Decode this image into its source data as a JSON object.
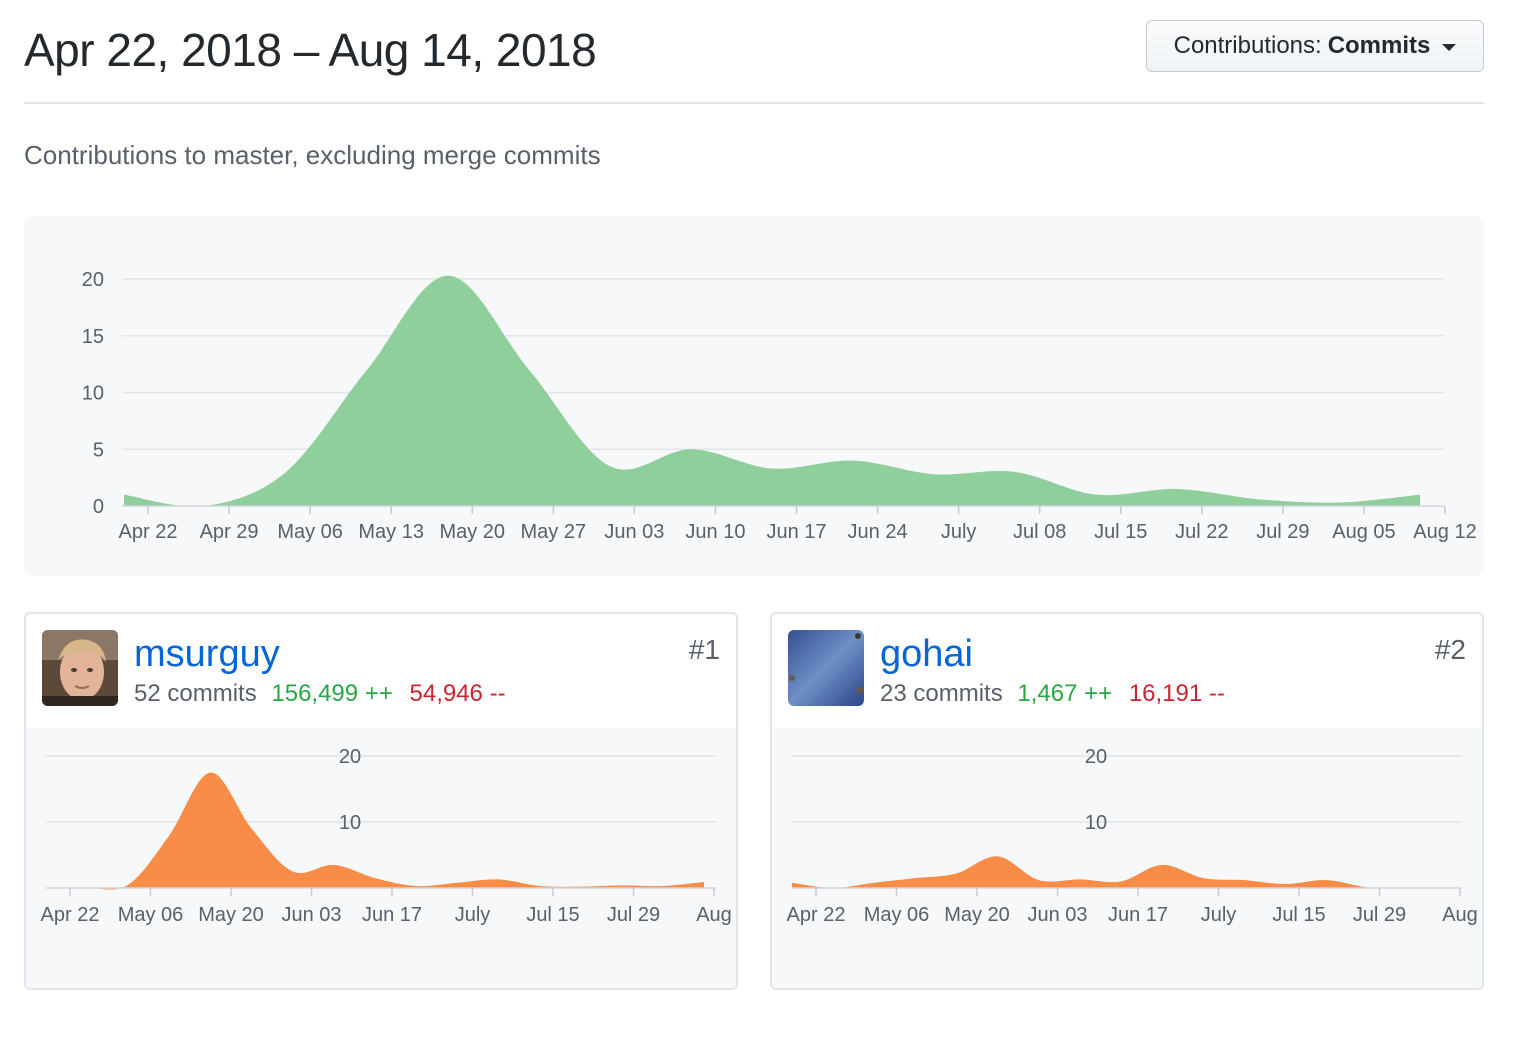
{
  "header": {
    "date_range": "Apr 22, 2018 – Aug 14, 2018",
    "contributions_label": "Contributions:",
    "contributions_value": "Commits"
  },
  "subtitle": "Contributions to master, excluding merge commits",
  "colors": {
    "main_area": "#8fcf9b",
    "contributor_area": "#f9863c",
    "link": "#0366d6",
    "additions": "#28a745",
    "deletions": "#cb2431"
  },
  "chart_data": [
    {
      "type": "area",
      "title": "",
      "ylabel": "",
      "ylim": [
        0,
        20
      ],
      "yticks": [
        0,
        5,
        10,
        15,
        20
      ],
      "grid": true,
      "x_tick_labels": [
        "Apr 22",
        "Apr 29",
        "May 06",
        "May 13",
        "May 20",
        "May 27",
        "Jun 03",
        "Jun 10",
        "Jun 17",
        "Jun 24",
        "July",
        "Jul 08",
        "Jul 15",
        "Jul 22",
        "Jul 29",
        "Aug 05",
        "Aug 12"
      ],
      "x": [
        "Apr 22",
        "Apr 29",
        "May 06",
        "May 13",
        "May 20",
        "May 27",
        "Jun 03",
        "Jun 10",
        "Jun 17",
        "Jun 24",
        "July",
        "Jul 08",
        "Jul 15",
        "Jul 22",
        "Jul 29",
        "Aug 05",
        "Aug 12"
      ],
      "series": [
        {
          "values": [
            1,
            0,
            3,
            12,
            20.3,
            12,
            3.5,
            5,
            3.3,
            4,
            2.8,
            3,
            1,
            1.5,
            0.6,
            0.3,
            1
          ]
        }
      ]
    },
    {
      "type": "area",
      "title": "",
      "ylim": [
        0,
        20
      ],
      "yticks": [
        10,
        20
      ],
      "grid": true,
      "x_tick_labels": [
        "Apr 22",
        "May 06",
        "May 20",
        "Jun 03",
        "Jun 17",
        "July",
        "Jul 15",
        "Jul 29",
        "Aug"
      ],
      "x": [
        "Apr 22",
        "Apr 29",
        "May 06",
        "May 13",
        "May 20",
        "May 27",
        "Jun 03",
        "Jun 10",
        "Jun 17",
        "Jun 24",
        "July",
        "Jul 08",
        "Jul 15",
        "Jul 22",
        "Jul 29",
        "Aug 05",
        "Aug 12"
      ],
      "series": [
        {
          "values": [
            0,
            0,
            0.5,
            8,
            17.5,
            9,
            2.5,
            3.5,
            1.5,
            0.3,
            0.8,
            1.3,
            0.3,
            0.2,
            0.4,
            0.3,
            0.9
          ]
        }
      ]
    },
    {
      "type": "area",
      "title": "",
      "ylim": [
        0,
        20
      ],
      "yticks": [
        10,
        20
      ],
      "grid": true,
      "x_tick_labels": [
        "Apr 22",
        "May 06",
        "May 20",
        "Jun 03",
        "Jun 17",
        "July",
        "Jul 15",
        "Jul 29",
        "Aug"
      ],
      "x": [
        "Apr 22",
        "Apr 29",
        "May 06",
        "May 13",
        "May 20",
        "May 27",
        "Jun 03",
        "Jun 10",
        "Jun 17",
        "Jun 24",
        "July",
        "Jul 08",
        "Jul 15",
        "Jul 22",
        "Jul 29",
        "Aug 05",
        "Aug 12"
      ],
      "series": [
        {
          "values": [
            0.8,
            0,
            0.8,
            1.5,
            2.2,
            4.8,
            1.2,
            1.3,
            1.0,
            3.5,
            1.5,
            1.2,
            0.6,
            1.2,
            0.1,
            0,
            0
          ]
        }
      ]
    }
  ],
  "contributors": [
    {
      "username": "msurguy",
      "commits": "52 commits",
      "additions": "156,499 ++",
      "deletions": "54,946 --",
      "rank": "#1"
    },
    {
      "username": "gohai",
      "commits": "23 commits",
      "additions": "1,467 ++",
      "deletions": "16,191 --",
      "rank": "#2"
    }
  ]
}
